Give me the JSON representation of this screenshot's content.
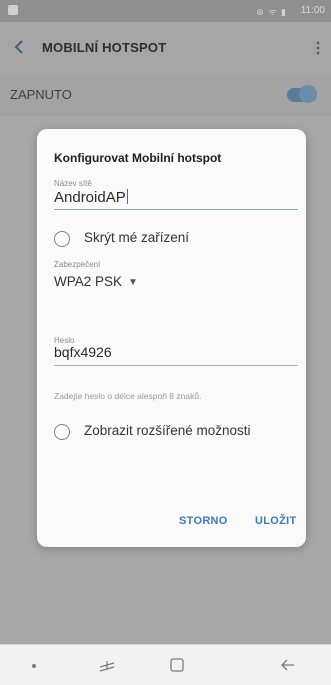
{
  "status_bar": {
    "time": "11:00",
    "icons": "⊗ ᯤ ▮"
  },
  "app_bar": {
    "title": "MOBILNÍ HOTSPOT",
    "back_icon": "chevron-left-icon",
    "more_icon": "more-vert-icon"
  },
  "toggle": {
    "label": "ZAPNUTO",
    "state": "on",
    "accent": "#5a7a96"
  },
  "dialog": {
    "title": "Konfigurovat Mobilní hotspot",
    "network_name": {
      "label": "Název sítě",
      "value": "AndroidAP"
    },
    "hide_device": {
      "label": "Skrýt mé zařízení",
      "checked": false
    },
    "security": {
      "label": "Zabezpečení",
      "value": "WPA2 PSK"
    },
    "password": {
      "label": "Heslo",
      "value": "bqfx4926",
      "hint": "Zadejte heslo o délce alespoň 8 znaků."
    },
    "advanced": {
      "label": "Zobrazit rozšířené možnosti",
      "checked": false
    },
    "buttons": {
      "cancel": "STORNO",
      "save": "ULOŽIT"
    },
    "accent": "#3f79b3"
  },
  "nav_bar": {
    "icons": [
      "dot-icon",
      "recent-apps-icon",
      "home-icon",
      "back-icon"
    ]
  }
}
